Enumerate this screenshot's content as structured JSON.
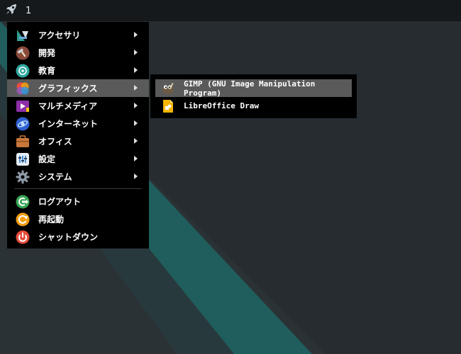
{
  "taskbar": {
    "launcher_icon": "rocket-icon",
    "workspace": "1"
  },
  "menu": {
    "items": [
      {
        "label": "アクセサリ",
        "icon": "accessories-icon",
        "submenu": true
      },
      {
        "label": "開発",
        "icon": "hammer-icon",
        "submenu": true
      },
      {
        "label": "教育",
        "icon": "education-icon",
        "submenu": true
      },
      {
        "label": "グラフィックス",
        "icon": "graphics-icon",
        "submenu": true,
        "selected": true
      },
      {
        "label": "マルチメディア",
        "icon": "multimedia-icon",
        "submenu": true
      },
      {
        "label": "インターネット",
        "icon": "internet-icon",
        "submenu": true
      },
      {
        "label": "オフィス",
        "icon": "briefcase-icon",
        "submenu": true
      },
      {
        "label": "設定",
        "icon": "settings-icon",
        "submenu": true
      },
      {
        "label": "システム",
        "icon": "system-gear-icon",
        "submenu": true
      }
    ],
    "session": [
      {
        "label": "ログアウト",
        "icon": "logout-icon"
      },
      {
        "label": "再起動",
        "icon": "reboot-icon"
      },
      {
        "label": "シャットダウン",
        "icon": "power-icon"
      }
    ]
  },
  "submenu": {
    "items": [
      {
        "label": "GIMP (GNU Image Manipulation Program)",
        "icon": "gimp-icon",
        "selected": true
      },
      {
        "label": "LibreOffice Draw",
        "icon": "libreoffice-draw-icon"
      }
    ]
  },
  "colors": {
    "wallpaper_dark": "#2b3236",
    "wallpaper_teal": "#1f5e5c",
    "menu_bg": "#000000",
    "selection": "#5a5a5a",
    "taskbar": "#15191c"
  }
}
